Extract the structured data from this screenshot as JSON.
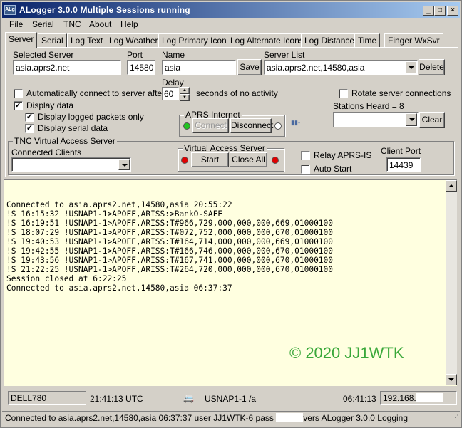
{
  "window": {
    "title": "ALogger 3.0.0 Multiple Sessions running",
    "icon_text": "ALg"
  },
  "menu": [
    "File",
    "Serial",
    "TNC",
    "About",
    "Help"
  ],
  "tabs": [
    "Server",
    "Serial",
    "Log Text",
    "Log Weather",
    "Log Primary Icons",
    "Log Alternate Icons",
    "Log Distance",
    "Time",
    "Finger WxSvr"
  ],
  "server": {
    "selected_label": "Selected Server",
    "selected_value": "asia.aprs2.net",
    "port_label": "Port",
    "port_value": "14580",
    "name_label": "Name",
    "name_value": "asia",
    "save": "Save",
    "list_label": "Server List",
    "list_value": "asia.aprs2.net,14580,asia",
    "delete": "Delete"
  },
  "options": {
    "auto_connect": "Automatically connect to server after",
    "auto_connect_checked": false,
    "delay_label": "Delay",
    "delay_value": "60",
    "delay_suffix": "seconds of no activity",
    "rotate": "Rotate server connections",
    "rotate_checked": false,
    "display_data": "Display data",
    "display_data_checked": true,
    "display_logged": "Display logged packets only",
    "display_logged_checked": true,
    "display_serial": "Display serial data",
    "display_serial_checked": true,
    "stations_heard": "Stations Heard = 8",
    "clear": "Clear"
  },
  "aprs": {
    "title": "APRS Internet",
    "connect": "Connect",
    "disconnect": "Disconnect",
    "left_color": "#22c322",
    "right_color": "#ffffff"
  },
  "tnc": {
    "title": "TNC Virtual Access Server",
    "clients_label": "Connected Clients"
  },
  "vas": {
    "title": "Virtual Access Server",
    "start": "Start",
    "close_all": "Close All",
    "left_color": "#e00000",
    "right_color": "#e00000"
  },
  "relay": {
    "relay_label": "Relay APRS-IS",
    "relay_checked": false,
    "auto_start": "Auto Start",
    "auto_start_checked": false,
    "client_port_label": "Client Port",
    "client_port_value": "14439"
  },
  "console": {
    "lines": [
      "Connected to asia.aprs2.net,14580,asia 20:55:22",
      "!S 16:15:32 !USNAP1-1>APOFF,ARISS:>BankO-SAFE",
      "!S 16:19:51 !USNAP1-1>APOFF,ARISS:T#966,729,000,000,000,669,01000100",
      "!S 18:07:29 !USNAP1-1>APOFF,ARISS:T#072,752,000,000,000,670,01000100",
      "!S 19:40:53 !USNAP1-1>APOFF,ARISS:T#164,714,000,000,000,669,01000100",
      "!S 19:42:55 !USNAP1-1>APOFF,ARISS:T#166,746,000,000,000,670,01000100",
      "!S 19:43:56 !USNAP1-1>APOFF,ARISS:T#167,741,000,000,000,670,01000100",
      "!S 21:22:25 !USNAP1-1>APOFF,ARISS:T#264,720,000,000,000,670,01000100",
      "Session closed at 6:22:25",
      "Connected to asia.aprs2.net,14580,asia 06:37:37"
    ],
    "watermark": "© 2020 JJ1WTK"
  },
  "status": {
    "host": "DELL780",
    "utc": "21:41:13 UTC",
    "last_station": "USNAP1-1 /a",
    "local_time": "06:41:13",
    "ip": "192.168."
  },
  "bottom": {
    "part1": "Connected to asia.aprs2.net,14580,asia 06:37:37 user JJ1WTK-6 pass ",
    "part2": "vers ALogger 3.0.0 Logging"
  }
}
